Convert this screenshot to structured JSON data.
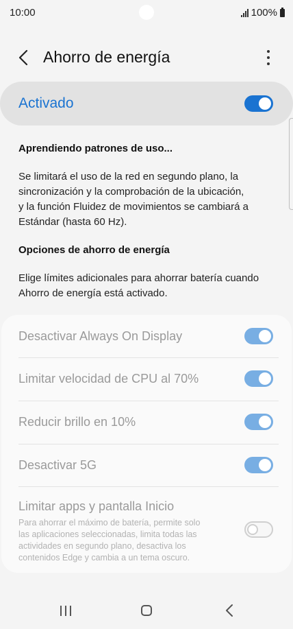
{
  "status_bar": {
    "time": "10:00",
    "battery": "100%",
    "icons": [
      "signal-icon",
      "battery-icon"
    ]
  },
  "header": {
    "title": "Ahorro de energía",
    "back_icon": "back-arrow-icon",
    "more_icon": "more-options-icon"
  },
  "master_toggle": {
    "label": "Activado",
    "state": "on",
    "accent": "#1a73d1"
  },
  "learning": {
    "heading": "Aprendiendo patrones de uso...",
    "lines": [
      "Se limitará el uso de la red en segundo plano, la",
      "sincronización y la comprobación de la ubicación,",
      "y la función Fluidez de movimientos se cambiará a",
      "Estándar (hasta 60 Hz)."
    ]
  },
  "options": {
    "heading": "Opciones de ahorro de energía",
    "lines": [
      "Elige límites adicionales para ahorrar batería cuando",
      "Ahorro de energía está activado."
    ]
  },
  "settings": [
    {
      "label": "Desactivar Always On Display",
      "state": "on"
    },
    {
      "label": "Limitar velocidad de CPU al 70%",
      "state": "on"
    },
    {
      "label": "Reducir brillo en 10%",
      "state": "on"
    },
    {
      "label": "Desactivar 5G",
      "state": "on"
    },
    {
      "label": "Limitar apps y pantalla Inicio",
      "state": "off",
      "description_lines": [
        "Para ahorrar el máximo de batería, permite solo",
        "las aplicaciones seleccionadas, limita todas las",
        "actividades en segundo plano, desactiva los",
        "contenidos Edge y cambia a un tema oscuro."
      ]
    }
  ],
  "nav_bar": {
    "icons": [
      "recent-apps-icon",
      "home-icon",
      "back-icon"
    ]
  }
}
